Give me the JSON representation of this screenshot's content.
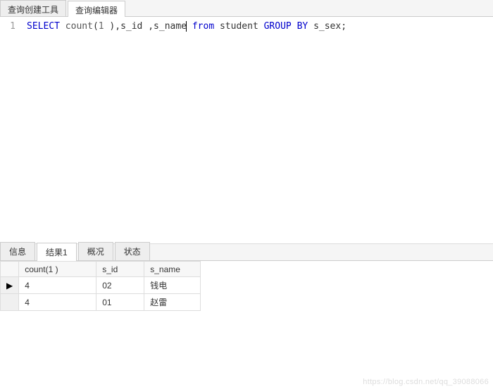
{
  "top_tabs": {
    "builder": "查询创建工具",
    "editor": "查询编辑器"
  },
  "editor": {
    "line_no": "1",
    "sql": {
      "kw_select": "SELECT",
      "func_count": "count",
      "lparen": "(",
      "arg": "1",
      "rparen_sp": " )",
      "comma1": ",",
      "id1": "s_id",
      "comma2": " ,",
      "id2": "s_name",
      "kw_from": "from",
      "tbl": "student",
      "kw_group": "GROUP",
      "kw_by": "BY",
      "id3": "s_sex",
      "semi": ";"
    }
  },
  "bottom_tabs": {
    "info": "信息",
    "result1": "结果1",
    "profile": "概况",
    "status": "状态"
  },
  "result": {
    "headers": {
      "count": "count(1 )",
      "s_id": "s_id",
      "s_name": "s_name"
    },
    "rows": [
      {
        "marker": "▶",
        "count": "4",
        "s_id": "02",
        "s_name": "钱电"
      },
      {
        "marker": "",
        "count": "4",
        "s_id": "01",
        "s_name": "赵雷"
      }
    ]
  },
  "watermark": "https://blog.csdn.net/qq_39088066",
  "chart_data": {
    "type": "table",
    "columns": [
      "count(1 )",
      "s_id",
      "s_name"
    ],
    "rows": [
      [
        4,
        "02",
        "钱电"
      ],
      [
        4,
        "01",
        "赵雷"
      ]
    ]
  }
}
